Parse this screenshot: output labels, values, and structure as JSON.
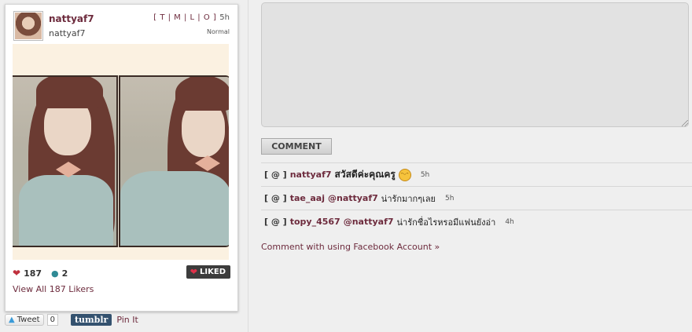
{
  "post": {
    "username": "nattyaf7",
    "subname": "nattyaf7",
    "filters": "[ T | M | L | O ]",
    "age": "5h",
    "filter_name": "Normal",
    "likes": "187",
    "comments": "2",
    "liked_label": "LIKED",
    "view_likers": "View All 187 Likers"
  },
  "share": {
    "tweet_label": "Tweet",
    "tweet_count": "0",
    "tumblr_label": "tumblr",
    "pin_label": "Pin It"
  },
  "composer": {
    "value": "",
    "button_label": "COMMENT"
  },
  "comments": [
    {
      "at": "[ @ ]",
      "user": "nattyaf7",
      "mention": "",
      "text": "สวัสดีค่ะคุณครู",
      "emoji": "grinning-emoji",
      "time": "5h"
    },
    {
      "at": "[ @ ]",
      "user": "tae_aaj",
      "mention": "@nattyaf7",
      "text": "น่ารักมากๆเลย",
      "time": "5h"
    },
    {
      "at": "[ @ ]",
      "user": "topy_4567",
      "mention": "@nattyaf7",
      "text": "น่ารักชื่อไรหรอมีแฟนยังอ่า",
      "time": "4h"
    }
  ],
  "facebook_link": "Comment with using Facebook Account »",
  "colors": {
    "accent": "#6d2b3d",
    "heart": "#c0313e",
    "liked_bg": "#3c3c3c"
  }
}
